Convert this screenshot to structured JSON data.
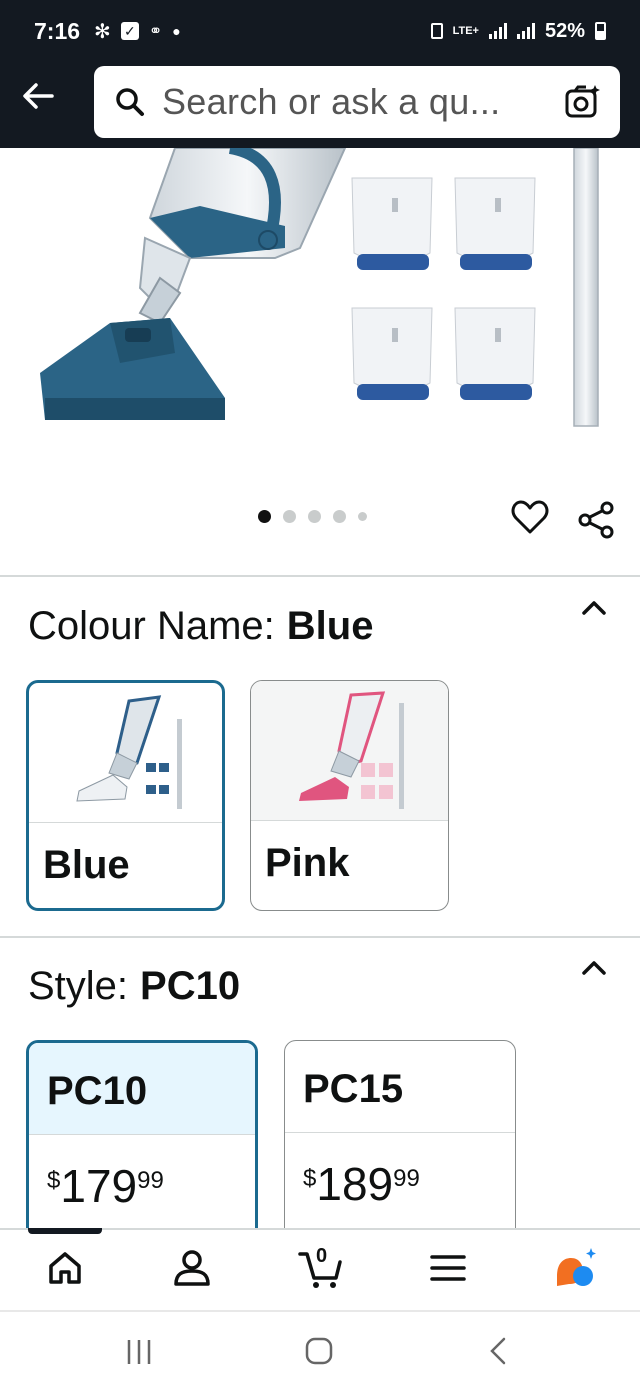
{
  "status_bar": {
    "time": "7:16",
    "battery": "52%",
    "network": "LTE+"
  },
  "search": {
    "placeholder": "Search or ask a qu..."
  },
  "gallery": {
    "image_count": 5,
    "active_index": 0
  },
  "colour": {
    "label": "Colour Name:",
    "selected": "Blue",
    "options": [
      {
        "name": "Blue",
        "accent": "#2e5f8a"
      },
      {
        "name": "Pink",
        "accent": "#e0557f"
      }
    ]
  },
  "style": {
    "label": "Style:",
    "selected": "PC10",
    "options": [
      {
        "name": "PC10",
        "currency": "$",
        "whole": "179",
        "fraction": "99"
      },
      {
        "name": "PC15",
        "currency": "$",
        "whole": "189",
        "fraction": "99"
      }
    ]
  },
  "bottom_nav": {
    "items": [
      "home-icon",
      "account-icon",
      "cart-icon",
      "menu-icon",
      "rufus-assistant-icon"
    ],
    "cart_count": "0"
  },
  "colors": {
    "header_bg": "#131921",
    "selected_border": "#1b6a8f",
    "selected_fill": "#e6f6fe",
    "product_blue": "#2e5f8a"
  }
}
